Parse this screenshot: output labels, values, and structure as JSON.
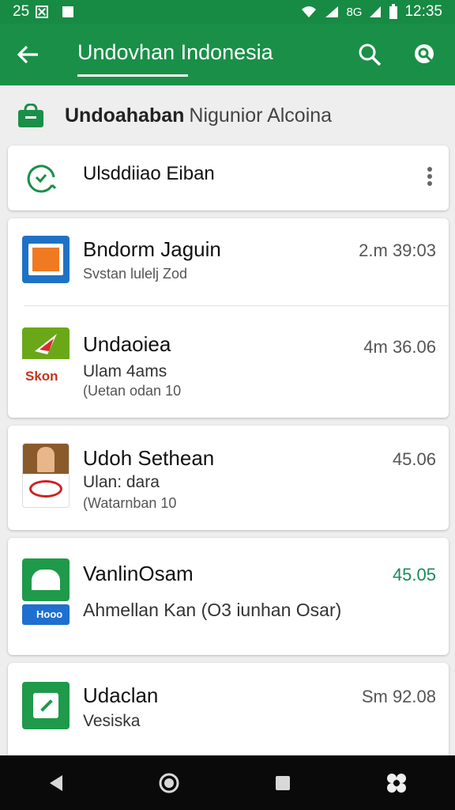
{
  "statusbar": {
    "time_left": "25",
    "time_right": "12:35",
    "signal_text": "8G"
  },
  "appbar": {
    "title": "Undovhan Indonesia"
  },
  "section": {
    "title_bold": "Undoahaban",
    "title_rest": "Nigunior Alcoina"
  },
  "card_header": {
    "label": "Ulsddiiao Eiban"
  },
  "items": [
    {
      "title": "Bndorm Jaguin",
      "subtitle": "Svstan lulelj Zod",
      "time": "2.m 39:03",
      "icon_text": ""
    },
    {
      "title": "Undaoiea",
      "subtitle": "Ulam 4ams",
      "detail": "(Uetan odan 10",
      "time": "4m 36.06",
      "icon_text": "Skon"
    },
    {
      "title": "Udoh Sethean",
      "subtitle": "Ulan: dara",
      "detail": "(Watarnban 10",
      "time": "45.06",
      "icon_text": ""
    },
    {
      "title": "VanlinOsam",
      "subtitle": "Ahmellan Kan (O3 iunhan Osar)",
      "time": "45.05",
      "icon_text": "Hooo"
    },
    {
      "title": "Udaclan",
      "subtitle": "Vesiska",
      "time": "Sm 92.08"
    }
  ],
  "colors": {
    "primary": "#1a8f48",
    "status": "#178a44",
    "accent_time": "#1a8a5a"
  }
}
